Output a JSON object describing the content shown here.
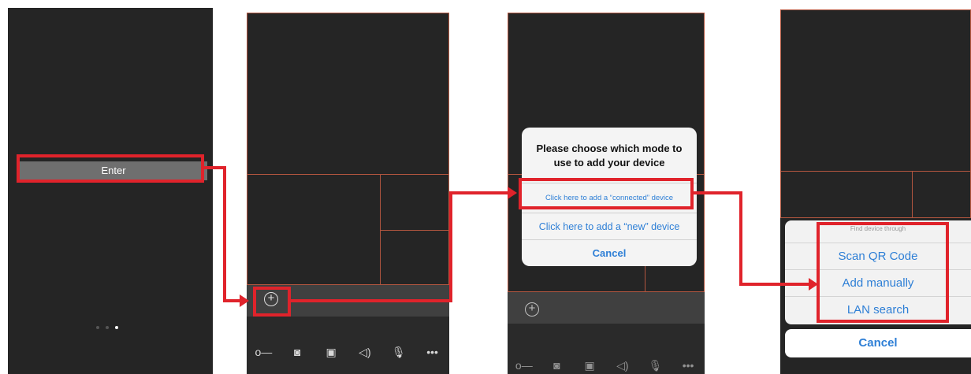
{
  "screen1": {
    "enter_label": "Enter"
  },
  "screen2": {
    "add_icon": "plus-circle-icon"
  },
  "toolbar_icons": [
    "key-icon",
    "camera-icon",
    "video-record-icon",
    "speaker-icon",
    "microphone-icon",
    "more-icon"
  ],
  "toolbar_glyphs": [
    "o—",
    "◙",
    "▣",
    "◁)",
    "🎙",
    "•••"
  ],
  "dialog": {
    "title_line1": "Please choose which mode to",
    "title_line2": "use to add your device",
    "option_connected": "Click here to add a “connected” device",
    "option_new": "Click here to add a “new” device",
    "cancel": "Cancel"
  },
  "sheet": {
    "header": "Find device through",
    "scan_qr": "Scan QR Code",
    "add_manually": "Add manually",
    "lan_search": "LAN search",
    "cancel": "Cancel"
  },
  "colors": {
    "annotation_red": "#e0232b",
    "link_blue": "#2e7fd6",
    "grid_orange": "#b3563f"
  }
}
